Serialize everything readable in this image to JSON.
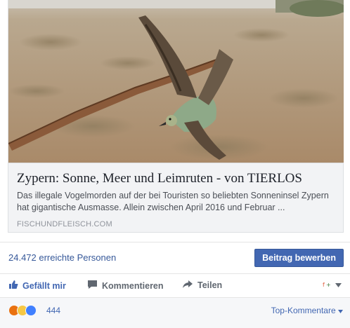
{
  "link_preview": {
    "title": "Zypern: Sonne, Meer und Leimruten - von TIERLOS",
    "description": "Das illegale Vogelmorden auf der bei Touristen so beliebten Sonneninsel Zypern hat gigantische Ausmasse. Allein zwischen April 2016 und Februar ...",
    "domain": "FISCHUNDFLEISCH.COM"
  },
  "reach": {
    "people_reached": "24.472 erreichte Personen",
    "boost_label": "Beitrag bewerben"
  },
  "actions": {
    "like_label": "Gefällt mir",
    "comment_label": "Kommentieren",
    "share_label": "Teilen"
  },
  "reactions": {
    "count": "444",
    "sort_label": "Top-Kommentare"
  },
  "colors": {
    "link_blue": "#4267b2",
    "boost_blue": "#4267b2",
    "card_bg": "#f2f3f5"
  }
}
